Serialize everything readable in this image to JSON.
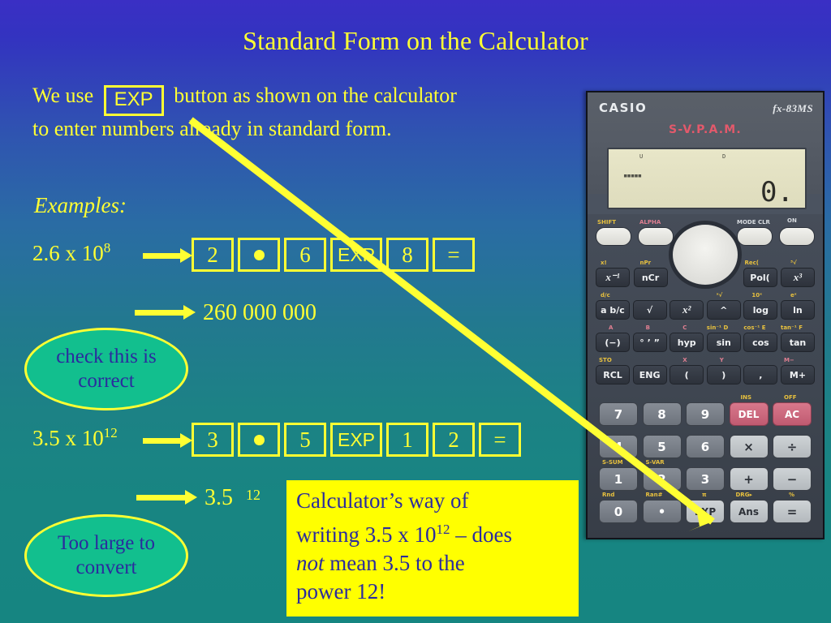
{
  "slide": {
    "title": "Standard Form on the Calculator",
    "intro": {
      "before": "We use",
      "boxed_key": "EXP",
      "after": "button as shown on the calculator to enter numbers already in standard form."
    },
    "examples_label": "Examples:",
    "examples": [
      {
        "expression_base": "2.6 x 10",
        "expression_exponent": "8",
        "keys": [
          "2",
          "•",
          "6",
          "EXP",
          "8",
          "="
        ],
        "result": "260 000 000",
        "note_label": "check this is correct"
      },
      {
        "expression_base": "3.5 x 10",
        "expression_exponent": "12",
        "keys": [
          "3",
          "•",
          "5",
          "EXP",
          "1",
          "2",
          "="
        ],
        "result_mantissa": "3.5",
        "result_exponent": "12",
        "note_label": "Too large to convert"
      }
    ],
    "callout": {
      "line1": "Calculator’s way of",
      "line2_a": "writing 3.5 x 10",
      "line2_exp": "12",
      "line2_b": " – does",
      "line3_italic": "not",
      "line3_rest": " mean 3.5 to the",
      "line4": "power 12!"
    },
    "colors": {
      "yellow": "#ffff33",
      "callout_bg": "#ffff00",
      "callout_text": "#2b2b9e",
      "ellipse_fill": "#12bf8e",
      "bg_top": "#3a2fc4",
      "bg_bottom": "#168581"
    }
  },
  "calculator": {
    "brand": "CASIO",
    "model": "fx-83MS",
    "vpam": "S-V.P.A.M.",
    "display": {
      "value": "0.",
      "dash": "▪▪▪▪▪",
      "indicator_left": "U",
      "indicator_right": "D"
    },
    "oval_keys": [
      {
        "label": "SHIFT",
        "label_color": "yellow"
      },
      {
        "label": "ALPHA",
        "label_color": "pink"
      },
      {
        "label": "MODE CLR",
        "label_color": "white"
      },
      {
        "label": "ON",
        "label_color": "white"
      }
    ],
    "function_rows": [
      {
        "sub": [
          "x!",
          "nPr",
          "",
          "",
          "Rec(",
          "³√"
        ],
        "keys": [
          "x⁻¹",
          "nCr",
          "",
          "",
          "Pol(",
          "x³"
        ]
      },
      {
        "sub": [
          "d/c",
          "",
          "",
          "ˣ√",
          "10ˣ",
          "eˣ"
        ],
        "keys": [
          "a b/c",
          "√",
          "x²",
          "^",
          "log",
          "ln"
        ]
      },
      {
        "sub": [
          "A",
          "B",
          "C",
          "sin⁻¹  D",
          "cos⁻¹  E",
          "tan⁻¹  F"
        ],
        "keys": [
          "(−)",
          "° ’ ”",
          "hyp",
          "sin",
          "cos",
          "tan"
        ]
      },
      {
        "sub": [
          "STO",
          "",
          "X",
          "Y",
          "M−",
          "M"
        ],
        "keys": [
          "RCL",
          "ENG",
          "(",
          ")",
          ",",
          "M+"
        ]
      }
    ],
    "numeric_rows": [
      {
        "sub": [
          "",
          "",
          "",
          "INS",
          "OFF"
        ],
        "keys": [
          "7",
          "8",
          "9",
          "DEL",
          "AC"
        ]
      },
      {
        "sub": [
          "",
          "",
          "",
          "",
          ""
        ],
        "keys": [
          "4",
          "5",
          "6",
          "×",
          "÷"
        ]
      },
      {
        "sub": [
          "S-SUM",
          "S-VAR",
          "",
          "",
          ""
        ],
        "keys": [
          "1",
          "2",
          "3",
          "+",
          "−"
        ]
      },
      {
        "sub": [
          "Rnd",
          "Ran#",
          "π",
          "DRG▸",
          "%"
        ],
        "keys": [
          "0",
          "•",
          "EXP",
          "Ans",
          "="
        ]
      }
    ]
  }
}
